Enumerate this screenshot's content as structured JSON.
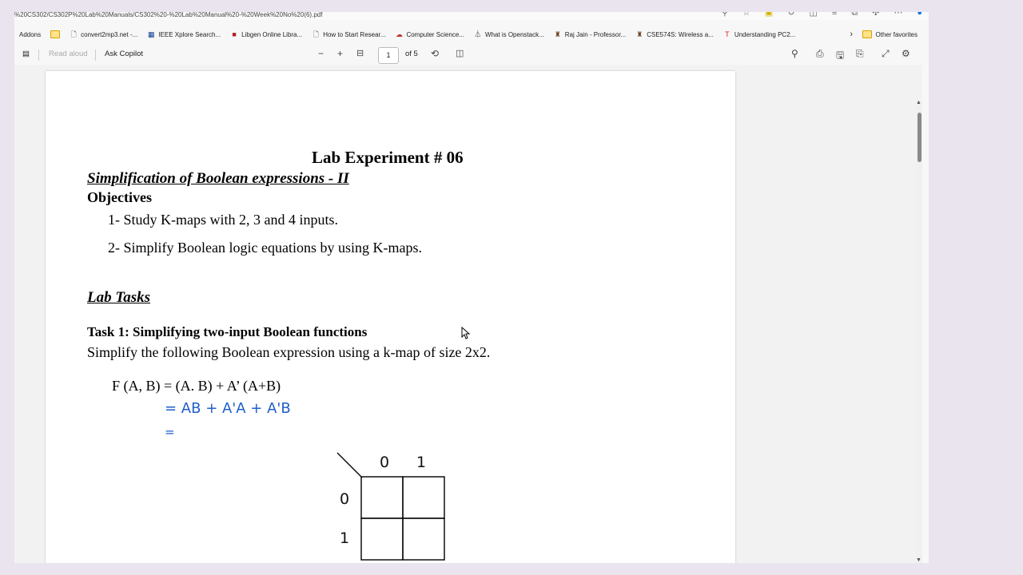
{
  "address_bar": {
    "url": "%20CS302/CS302P%20Lab%20Manuals/CS302%20-%20Lab%20Manual%20-%20Week%20No%20(6).pdf"
  },
  "favorites": {
    "items": [
      {
        "label": "Addons",
        "icon": "none"
      },
      {
        "label": "",
        "icon": "folder-icon"
      },
      {
        "label": "convert2mp3.net -...",
        "icon": "page-icon"
      },
      {
        "label": "IEEE Xplore Search...",
        "icon": "ieee-icon"
      },
      {
        "label": "Libgen Online Libra...",
        "icon": "libgen-icon"
      },
      {
        "label": "How to Start Resear...",
        "icon": "page-icon"
      },
      {
        "label": "Computer Science...",
        "icon": "cloud-icon"
      },
      {
        "label": "What is Openstack...",
        "icon": "openstack-icon"
      },
      {
        "label": "Raj Jain - Professor...",
        "icon": "person-icon"
      },
      {
        "label": "CSE574S: Wireless a...",
        "icon": "person-icon"
      },
      {
        "label": "Understanding PC2...",
        "icon": "it-icon"
      }
    ],
    "other_favorites": "Other favorites"
  },
  "pdf_toolbar": {
    "read_aloud": "Read aloud",
    "ask_copilot": "Ask Copilot",
    "zoom_out": "−",
    "zoom_in": "+",
    "page_current": "1",
    "page_total": "of 5"
  },
  "document": {
    "title": "Lab Experiment # 06",
    "subtitle": "Simplification of Boolean expressions - II",
    "objectives_heading": "Objectives",
    "objectives": [
      "1-  Study K-maps with 2, 3 and 4 inputs.",
      "2-  Simplify Boolean logic equations by using K-maps."
    ],
    "lab_tasks_heading": "Lab Tasks",
    "task1_heading": "Task 1: Simplifying two-input Boolean functions",
    "task1_description": "Simplify the following Boolean expression using a k-map of size 2x2.",
    "equation": "F (A, B) = (A. B) + A’ (A+B)",
    "handwritten_line1": "= AB + A'A + A'B",
    "handwritten_line2": "=",
    "kmap": {
      "col_labels": [
        "0",
        "1"
      ],
      "row_labels": [
        "0",
        "1"
      ]
    }
  },
  "colors": {
    "handwriting": "#1f5fc9",
    "edge_profile": "#1a73e8"
  }
}
